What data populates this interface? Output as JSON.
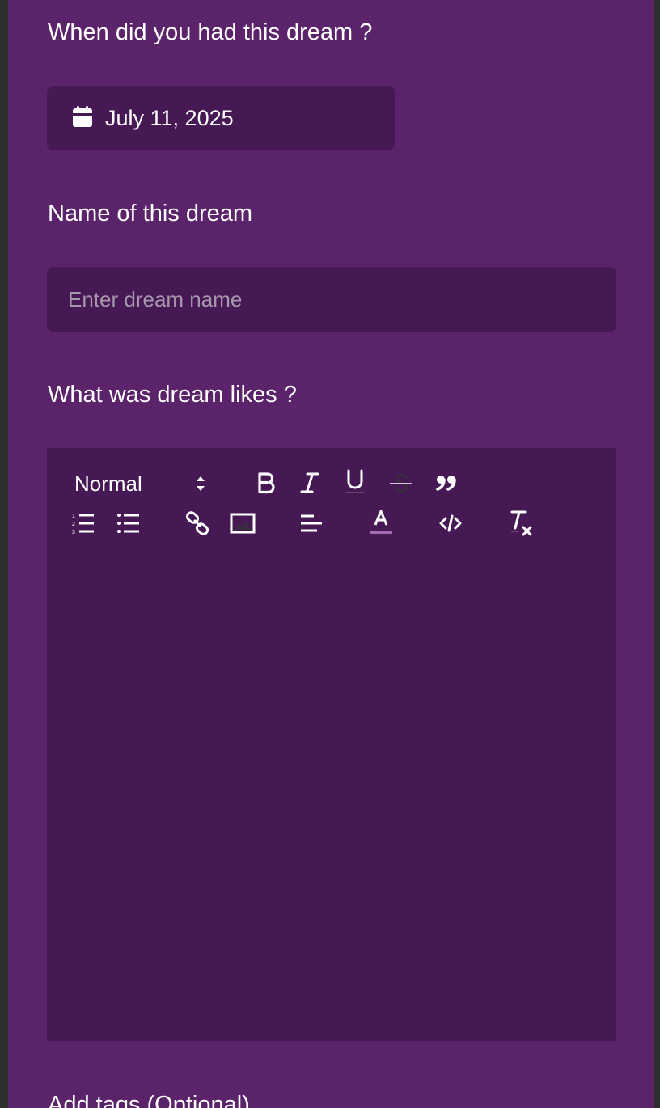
{
  "form": {
    "date_label": "When did you had this dream ?",
    "date_value": "July 11, 2025",
    "name_label": "Name of this dream",
    "name_placeholder": "Enter dream name",
    "name_value": "",
    "likes_label": "What was dream likes ?",
    "tags_label": "Add tags (Optional)"
  },
  "editor": {
    "header_select": "Normal",
    "tools_row1": [
      "bold-icon",
      "italic-icon",
      "underline-icon",
      "strikethrough-icon",
      "blockquote-icon"
    ],
    "tools_row2": [
      "ordered-list-icon",
      "bullet-list-icon",
      "link-icon",
      "image-icon",
      "align-left-icon",
      "text-color-icon",
      "code-block-icon",
      "clear-format-icon"
    ]
  },
  "colors": {
    "panel_bg": "#5b246a",
    "field_bg": "#461854",
    "outer_bg": "#2b302e",
    "text": "#ffffff",
    "placeholder": "#a797ad"
  }
}
